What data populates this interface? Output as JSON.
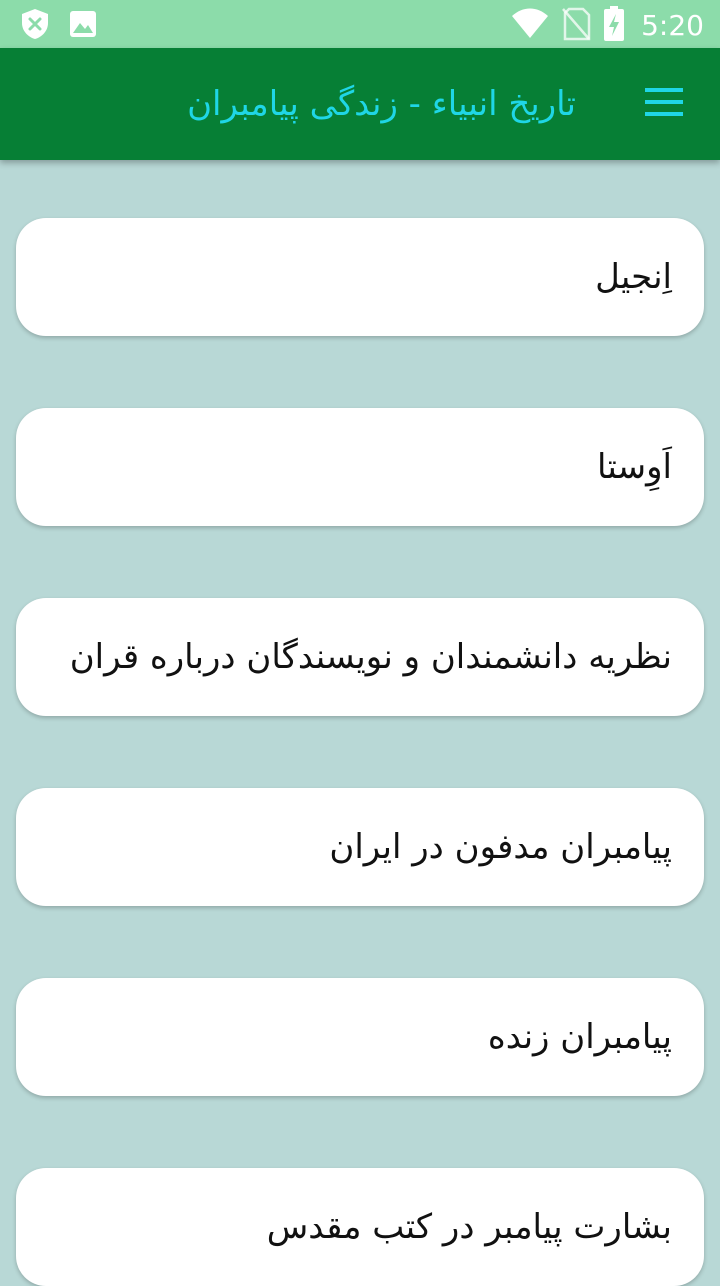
{
  "status_bar": {
    "time": "5:20",
    "icons_left": [
      "shield-x-icon",
      "image-icon"
    ],
    "icons_right": [
      "wifi-icon",
      "no-sim-icon",
      "battery-charging-icon"
    ]
  },
  "app_bar": {
    "title": "تاریخ انبیاء - زندگی پیامبران",
    "menu_icon": "hamburger-menu-icon",
    "background_color": "#067f35",
    "title_color": "#1fd6e6"
  },
  "list": {
    "items": [
      {
        "label": "اِنجیل"
      },
      {
        "label": "اَوِستا"
      },
      {
        "label": "نظریه دانشمندان و نویسندگان درباره قران"
      },
      {
        "label": "پیامبران مدفون در ایران"
      },
      {
        "label": "پیامبران زنده"
      },
      {
        "label": "بشارت پیامبر در کتب مقدس"
      }
    ]
  }
}
